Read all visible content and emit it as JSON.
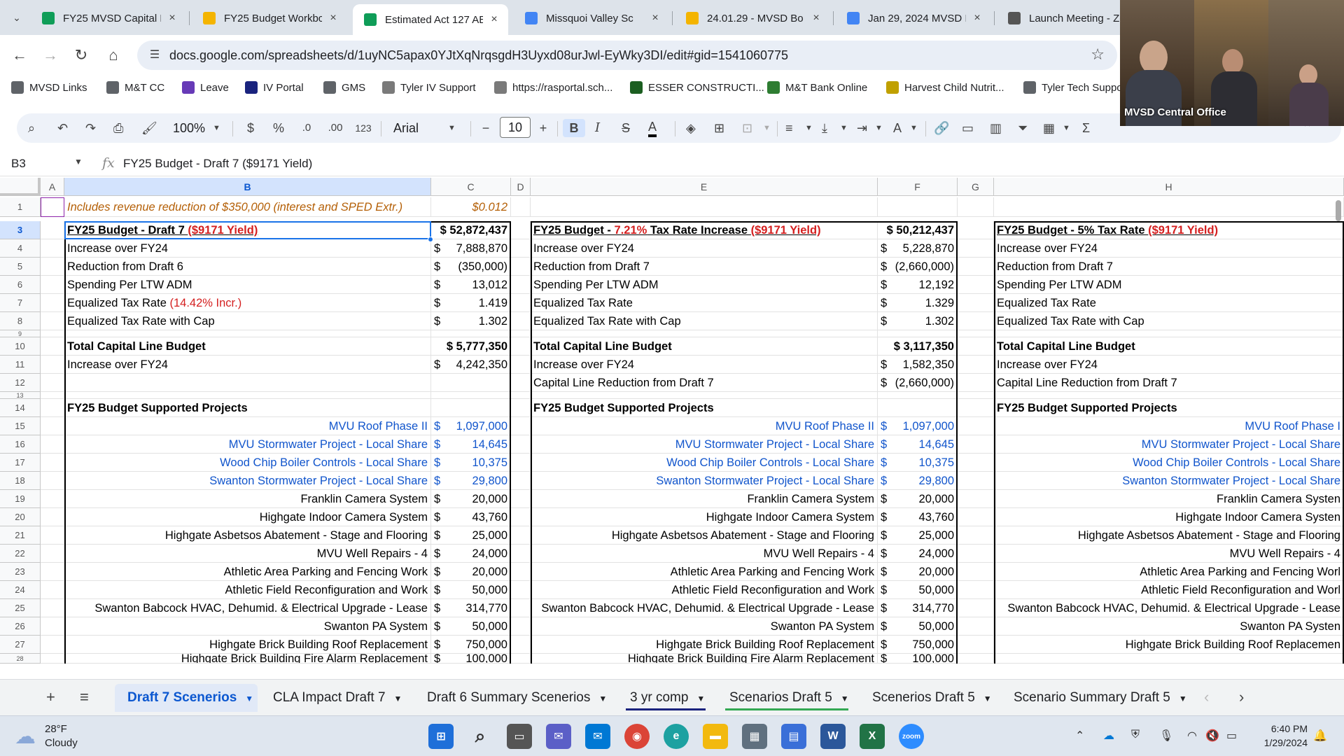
{
  "browser": {
    "tabs": [
      {
        "title": "FY25 MVSD Capital F",
        "icon": "sheets-icon",
        "color": "#0f9d58"
      },
      {
        "title": "FY25 Budget Workbc",
        "icon": "slides-icon",
        "color": "#f4b400"
      },
      {
        "title": "Estimated Act 127 AE",
        "icon": "sheets-icon",
        "color": "#0f9d58",
        "active": true
      },
      {
        "title": "Missquoi Valley Sc",
        "icon": "docs-icon",
        "color": "#4285f4"
      },
      {
        "title": "24.01.29 - MVSD Bo",
        "icon": "drive-icon",
        "color": "#f4b400"
      },
      {
        "title": "Jan 29, 2024 MVSD I",
        "icon": "docs-icon",
        "color": "#4285f4"
      },
      {
        "title": "Launch Meeting - Zo",
        "icon": "globe-icon",
        "color": "#555555"
      }
    ],
    "url": "docs.google.com/spreadsheets/d/1uyNC5apax0YJtXqNrqsgdH3Uyxd08urJwl-EyWky3DI/edit#gid=1541060775"
  },
  "bookmarks": [
    {
      "label": "MVSD Links",
      "icon": "folder-icon"
    },
    {
      "label": "M&T CC",
      "icon": "globe-icon"
    },
    {
      "label": "Leave",
      "icon": "forms-icon"
    },
    {
      "label": "IV Portal",
      "icon": "portal-icon"
    },
    {
      "label": "GMS",
      "icon": "globe-icon"
    },
    {
      "label": "Tyler IV Support",
      "icon": "tyler-icon"
    },
    {
      "label": "https://rasportal.sch...",
      "icon": "tyler-icon"
    },
    {
      "label": "ESSER CONSTRUCTI...",
      "icon": "esser-icon"
    },
    {
      "label": "M&T Bank Online",
      "icon": "mt-bank-icon"
    },
    {
      "label": "Harvest Child Nutrit...",
      "icon": "harvest-icon"
    },
    {
      "label": "Tyler Tech Suppo",
      "icon": "globe-icon"
    }
  ],
  "toolbar": {
    "zoom": "100%",
    "currency": "$",
    "percent": "%",
    "dec_less": ".0",
    "dec_more": ".00",
    "number_format": "123",
    "font": "Arial",
    "font_size": "10"
  },
  "formula_bar": {
    "cell_ref": "B3",
    "fx": "fx",
    "formula": "FY25 Budget - Draft 7 ($9171 Yield)"
  },
  "columns": [
    "A",
    "B",
    "C",
    "D",
    "E",
    "F",
    "G",
    "H"
  ],
  "rows": [
    "1",
    "3",
    "4",
    "5",
    "6",
    "7",
    "8",
    "9",
    "10",
    "11",
    "12",
    "13",
    "14",
    "15",
    "16",
    "17",
    "18",
    "19",
    "20",
    "21",
    "22",
    "23",
    "24",
    "25",
    "26",
    "27",
    "28"
  ],
  "sheet": {
    "row1": {
      "note": "Includes revenue reduction of $350,000 (interest and SPED Extr.)",
      "value": "$0.012"
    },
    "scenario1": {
      "title_main": "FY25 Budget - Draft 7 ",
      "title_red": "($9171 Yield)",
      "total": "$ 52,872,437",
      "lines": [
        {
          "label": "Increase over FY24",
          "cur": "$",
          "amt": "7,888,870"
        },
        {
          "label": "Reduction from Draft 6",
          "cur": "$",
          "amt": "(350,000)"
        },
        {
          "label": "Spending Per LTW ADM",
          "cur": "$",
          "amt": "13,012"
        },
        {
          "label": "Equalized Tax Rate ",
          "label_red": "(14.42% Incr.)",
          "cur": "$",
          "amt": "1.419"
        },
        {
          "label": "Equalized Tax Rate with Cap",
          "cur": "$",
          "amt": "1.302"
        }
      ],
      "capital_title": "Total Capital Line Budget",
      "capital_total": "$ 5,777,350",
      "capital_lines": [
        {
          "label": "Increase over FY24",
          "cur": "$",
          "amt": "4,242,350"
        },
        {
          "label": "",
          "cur": "",
          "amt": ""
        }
      ]
    },
    "scenario2": {
      "title_main": "FY25 Budget - ",
      "title_red1": "7.21%",
      "title_main2": " Tax Rate Increase ",
      "title_red": "($9171 Yield)",
      "total": "$ 50,212,437",
      "lines": [
        {
          "label": "Increase over FY24",
          "cur": "$",
          "amt": "5,228,870"
        },
        {
          "label": "Reduction from Draft 7",
          "cur": "$",
          "amt": "(2,660,000)"
        },
        {
          "label": "Spending Per LTW ADM",
          "cur": "$",
          "amt": "12,192"
        },
        {
          "label": "Equalized Tax Rate",
          "cur": "$",
          "amt": "1.329"
        },
        {
          "label": "Equalized Tax Rate with Cap",
          "cur": "$",
          "amt": "1.302"
        }
      ],
      "capital_title": "Total Capital Line Budget",
      "capital_total": "$ 3,117,350",
      "capital_lines": [
        {
          "label": "Increase over FY24",
          "cur": "$",
          "amt": "1,582,350"
        },
        {
          "label": "Capital Line Reduction from Draft 7",
          "cur": "$",
          "amt": "(2,660,000)"
        }
      ]
    },
    "scenario3": {
      "title_main": "FY25 Budget - 5% Tax Rate ",
      "title_red": "($9171 Yield)",
      "lines": [
        {
          "label": "Increase over FY24"
        },
        {
          "label": "Reduction from Draft 7"
        },
        {
          "label": "Spending Per LTW ADM"
        },
        {
          "label": "Equalized Tax Rate"
        },
        {
          "label": "Equalized Tax Rate with Cap"
        }
      ],
      "capital_title": "Total Capital Line Budget",
      "capital_lines": [
        {
          "label": "Increase over FY24"
        },
        {
          "label": "Capital Line Reduction from Draft 7"
        }
      ]
    },
    "projects_title": "FY25 Budget Supported Projects",
    "projects": [
      {
        "name": "MVU Roof Phase II",
        "amt": "1,097,000",
        "blue": true,
        "name_h": "MVU Roof Phase I"
      },
      {
        "name": "MVU Stormwater Project - Local Share",
        "amt": "14,645",
        "blue": true,
        "name_h": "MVU Stormwater Project - Local Share"
      },
      {
        "name": "Wood Chip Boiler Controls - Local Share",
        "amt": "10,375",
        "blue": true,
        "name_h": "Wood Chip Boiler Controls - Local Share"
      },
      {
        "name": "Swanton Stormwater Project - Local Share",
        "amt": "29,800",
        "blue": true,
        "name_h": "Swanton Stormwater Project - Local Share"
      },
      {
        "name": "Franklin Camera System",
        "amt": "20,000",
        "blue": false,
        "name_h": "Franklin Camera Systen"
      },
      {
        "name": "Highgate Indoor Camera System",
        "amt": "43,760",
        "blue": false,
        "name_h": "Highgate Indoor Camera Systen"
      },
      {
        "name": "Highgate Asbetsos Abatement - Stage and Flooring",
        "amt": "25,000",
        "blue": false,
        "name_h": "Highgate Asbetsos Abatement - Stage and Flooring"
      },
      {
        "name": "MVU Well Repairs - 4",
        "amt": "24,000",
        "blue": false,
        "name_h": "MVU Well Repairs - 4"
      },
      {
        "name": "Athletic Area Parking and Fencing Work",
        "amt": "20,000",
        "blue": false,
        "name_h": "Athletic Area Parking and Fencing Worl"
      },
      {
        "name": "Athletic Field Reconfiguration and Work",
        "amt": "50,000",
        "blue": false,
        "name_h": "Athletic Field Reconfiguration and Worl"
      },
      {
        "name": "Swanton Babcock HVAC, Dehumid. & Electrical Upgrade - Lease",
        "amt": "314,770",
        "blue": false,
        "name_h": "Swanton Babcock HVAC, Dehumid. & Electrical Upgrade - Lease"
      },
      {
        "name": "Swanton PA System",
        "amt": "50,000",
        "blue": false,
        "name_h": "Swanton PA Systen"
      },
      {
        "name": "Highgate Brick Building Roof Replacement",
        "amt": "750,000",
        "blue": false,
        "name_h": "Highgate Brick Building Roof Replacemen"
      },
      {
        "name": "Highgate Brick Building Fire Alarm Replacement",
        "amt": "100,000",
        "blue": false,
        "name_h": ""
      }
    ]
  },
  "sheet_tabs": [
    {
      "label": "Draft 7 Scenerios",
      "active": true,
      "color": ""
    },
    {
      "label": "CLA Impact Draft 7",
      "active": false,
      "color": ""
    },
    {
      "label": "Draft 6 Summary Scenerios",
      "active": false,
      "color": ""
    },
    {
      "label": "3 yr comp",
      "active": false,
      "color": "#1a237e"
    },
    {
      "label": "Scenarios Draft 5",
      "active": false,
      "color": "#34a853"
    },
    {
      "label": "Scenerios Draft 5",
      "active": false,
      "color": ""
    },
    {
      "label": "Scenario Summary Draft 5",
      "active": false,
      "color": ""
    }
  ],
  "video": {
    "label": "MVSD Central Office"
  },
  "taskbar": {
    "temp": "28°F",
    "weather": "Cloudy",
    "time": "6:40 PM",
    "date": "1/29/2024"
  }
}
